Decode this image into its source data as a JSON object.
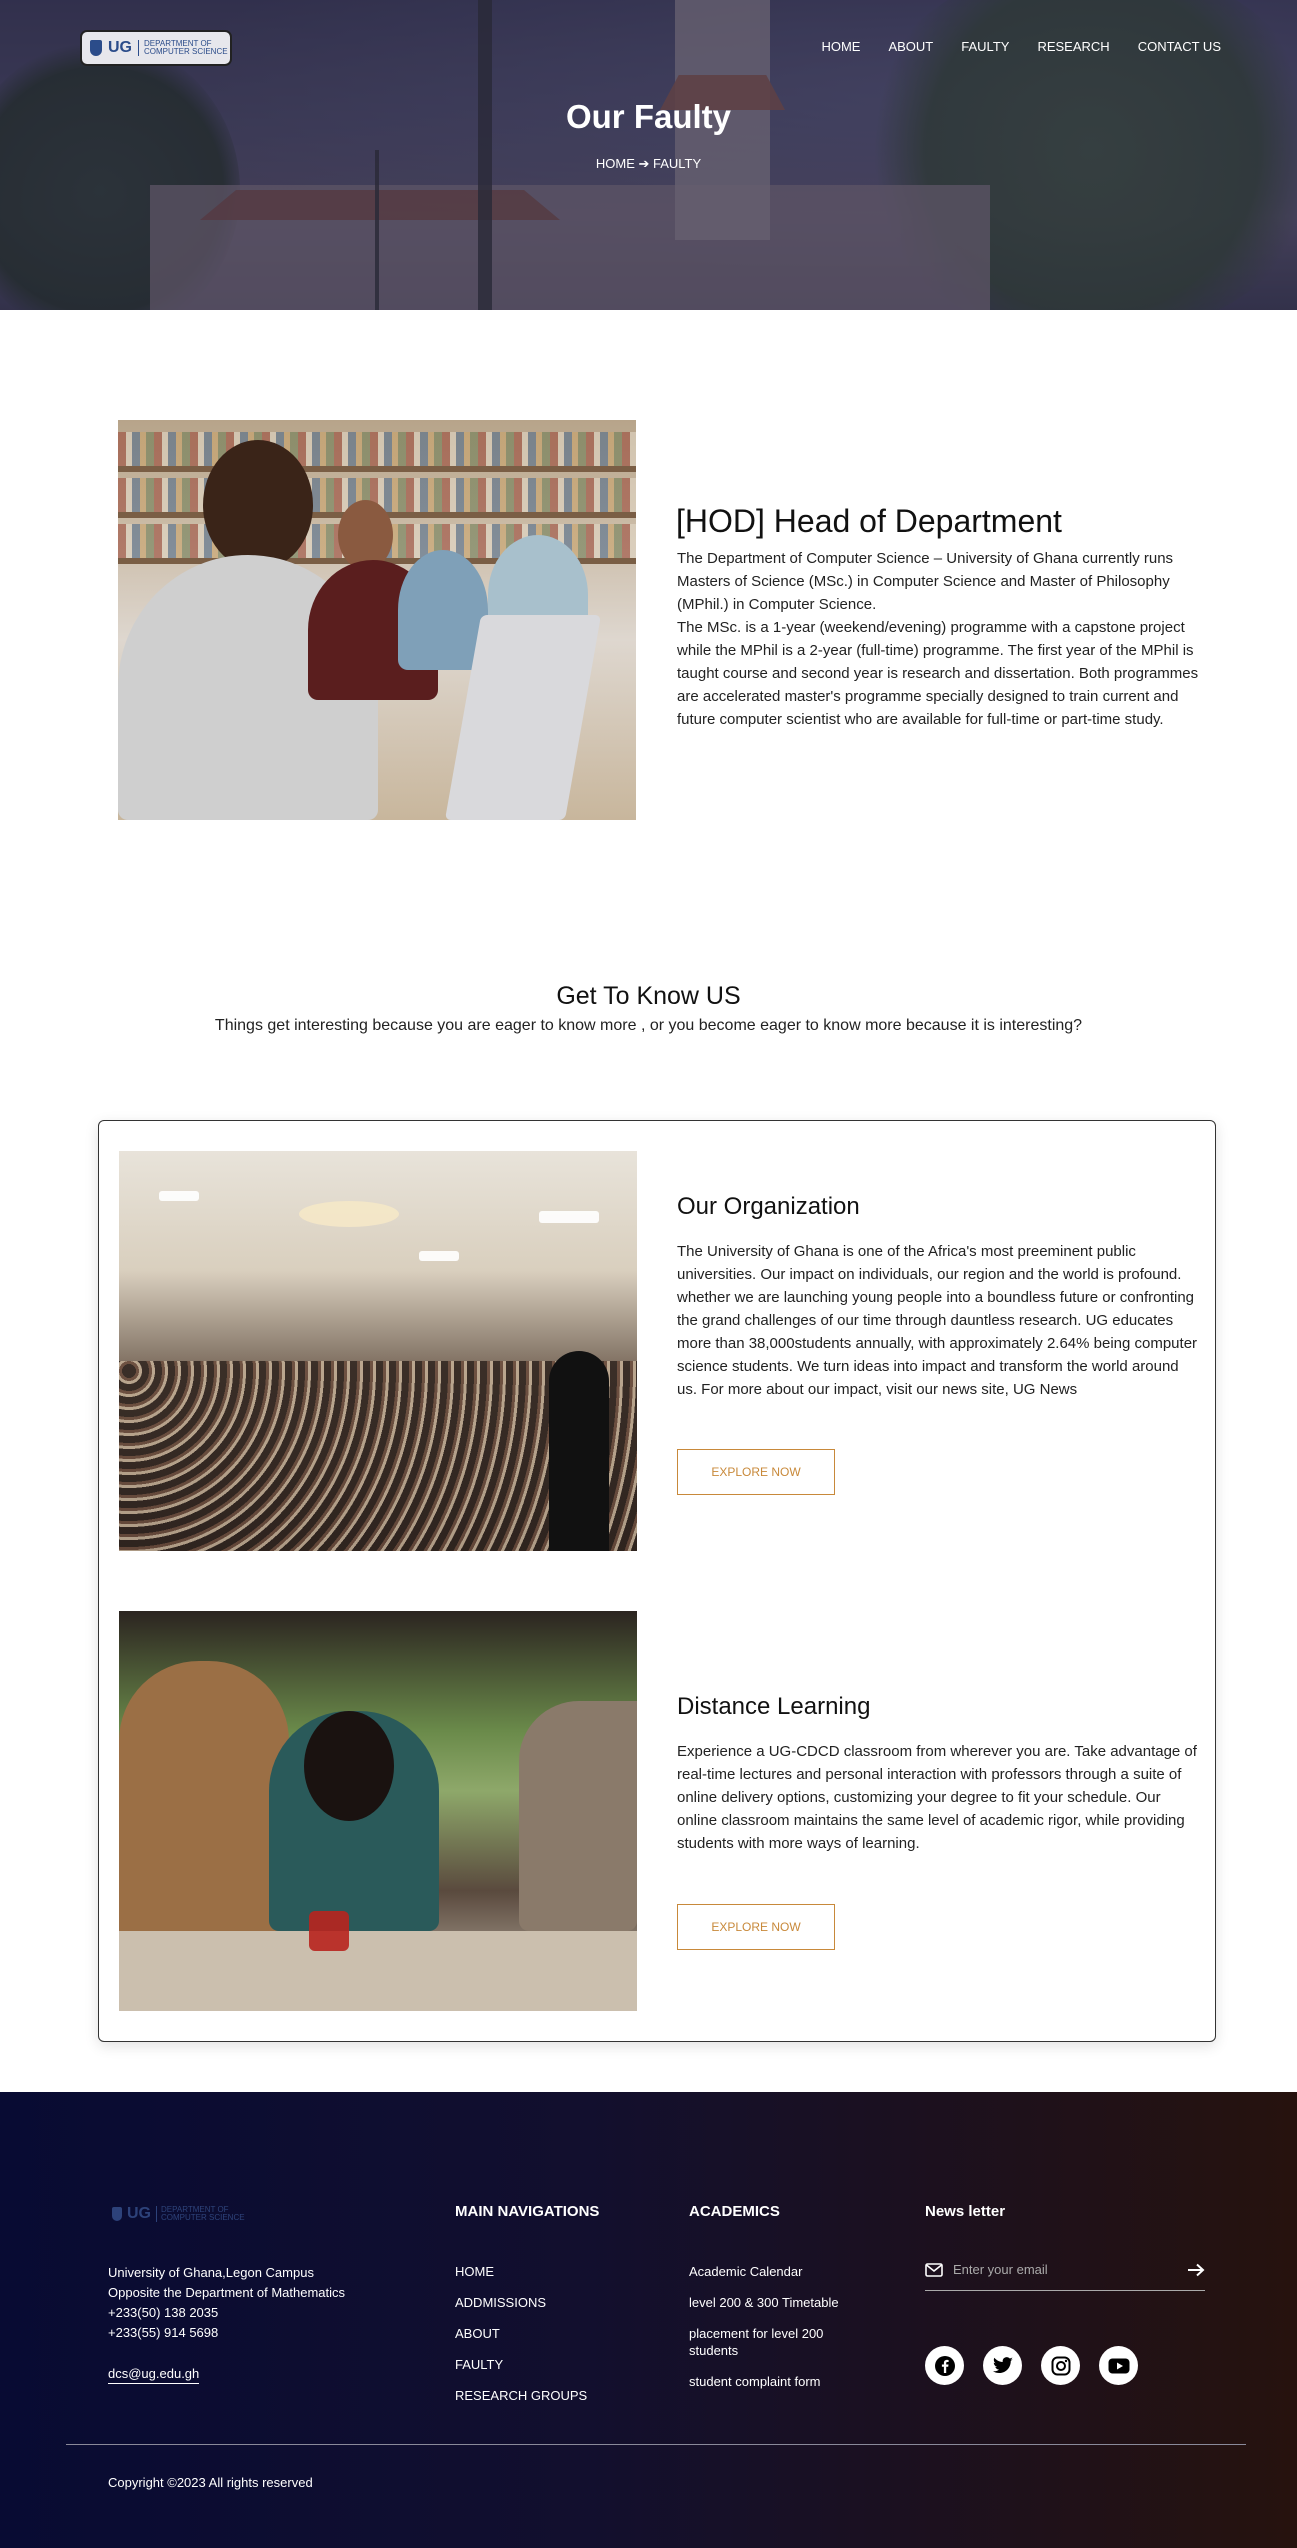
{
  "header": {
    "logo": {
      "abbr": "UG",
      "dept_line1": "DEPARTMENT OF",
      "dept_line2": "COMPUTER SCIENCE"
    },
    "nav": [
      "HOME",
      "ABOUT",
      "FAULTY",
      "RESEARCH",
      "CONTACT US"
    ]
  },
  "hero": {
    "title": "Our Faulty",
    "breadcrumb": "HOME ➔ FAULTY"
  },
  "hod": {
    "title": "[HOD] Head of Department",
    "paragraph1": "The Department of Computer Science – University of Ghana currently runs Masters of Science (MSc.) in Computer Science and Master of Philosophy (MPhil.) in Computer Science.",
    "paragraph2": "The MSc. is a 1-year (weekend/evening) programme with a capstone project while the MPhil is a 2-year (full-time) programme. The first year of the MPhil is taught course and second year is research and dissertation. Both programmes are accelerated master's programme specially designed to train current and future computer scientist who are available for full-time or part-time study."
  },
  "get_to_know": {
    "title": "Get To Know US",
    "subtitle": "Things get interesting because you are eager to know more , or you become eager to know more because it is interesting?"
  },
  "organization": {
    "title": "Our Organization",
    "text": "The University of Ghana is one of the Africa's most preeminent public universities. Our impact on individuals, our region and the world is profound. whether we are launching young people into a boundless future or confronting the grand challenges of our time through dauntless research. UG educates more than 38,000students annually, with approximately 2.64% being computer science students. We turn ideas into impact and transform the world around us. For more about our impact, visit our news site, UG News",
    "button": "EXPLORE NOW"
  },
  "distance": {
    "title": "Distance Learning",
    "text": "Experience a UG-CDCD classroom from wherever you are. Take advantage of real-time lectures and personal interaction with professors through a suite of online delivery options, customizing your degree to fit your schedule. Our online classroom maintains the same level of academic rigor, while providing students with more ways of learning.",
    "button": "EXPLORE NOW"
  },
  "footer": {
    "address": [
      "University of Ghana,Legon Campus",
      "Opposite the Department of Mathematics",
      "+233(50) 138 2035",
      "+233(55) 914 5698"
    ],
    "email": "dcs@ug.edu.gh",
    "nav_heading": "MAIN NAVIGATIONS",
    "nav_links": [
      "HOME",
      "ADDMISSIONS",
      "ABOUT",
      "FAULTY",
      "RESEARCH GROUPS"
    ],
    "academics_heading": "ACADEMICS",
    "academics_links": [
      "Academic Calendar",
      "level 200 & 300 Timetable",
      "placement for level 200 students",
      "student complaint form"
    ],
    "newsletter_heading": "News letter",
    "newsletter_placeholder": "Enter your email",
    "socials": [
      "facebook-icon",
      "twitter-icon",
      "instagram-icon",
      "youtube-icon"
    ],
    "copyright": "Copyright ©2023 All rights reserved"
  }
}
